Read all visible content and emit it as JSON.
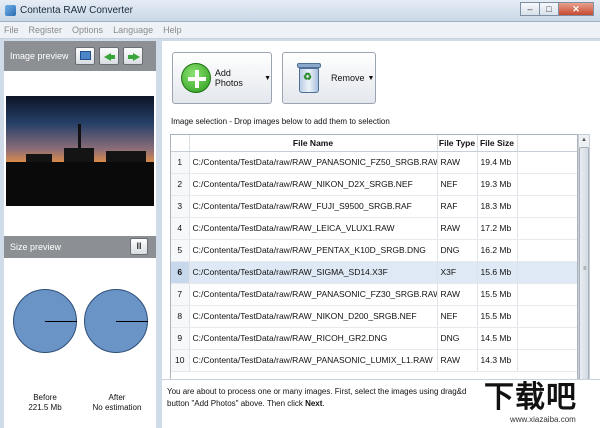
{
  "window": {
    "title": "Contenta RAW Converter",
    "min": "‒",
    "max": "□",
    "close": "✕"
  },
  "menu": [
    "File",
    "Register",
    "Options",
    "Language",
    "Help"
  ],
  "left": {
    "preview_label": "Image preview",
    "size_label": "Size preview",
    "pause": "II",
    "before_label": "Before",
    "before_value": "221.5 Mb",
    "after_label": "After",
    "after_value": "No estimation"
  },
  "toolbar": {
    "add": "Add Photos",
    "remove": "Remove",
    "caret": "▼"
  },
  "selection_label": "Image selection - Drop images below to add them to selection",
  "table": {
    "headers": {
      "name": "File Name",
      "type": "File Type",
      "size": "File Size"
    },
    "rows": [
      {
        "n": "1",
        "name": "C:/Contenta/TestData/raw/RAW_PANASONIC_FZ50_SRGB.RAW",
        "type": "RAW",
        "size": "19.4 Mb"
      },
      {
        "n": "2",
        "name": "C:/Contenta/TestData/raw/RAW_NIKON_D2X_SRGB.NEF",
        "type": "NEF",
        "size": "19.3 Mb"
      },
      {
        "n": "3",
        "name": "C:/Contenta/TestData/raw/RAW_FUJI_S9500_SRGB.RAF",
        "type": "RAF",
        "size": "18.3 Mb"
      },
      {
        "n": "4",
        "name": "C:/Contenta/TestData/raw/RAW_LEICA_VLUX1.RAW",
        "type": "RAW",
        "size": "17.2 Mb"
      },
      {
        "n": "5",
        "name": "C:/Contenta/TestData/raw/RAW_PENTAX_K10D_SRGB.DNG",
        "type": "DNG",
        "size": "16.2 Mb"
      },
      {
        "n": "6",
        "name": "C:/Contenta/TestData/raw/RAW_SIGMA_SD14.X3F",
        "type": "X3F",
        "size": "15.6 Mb"
      },
      {
        "n": "7",
        "name": "C:/Contenta/TestData/raw/RAW_PANASONIC_FZ30_SRGB.RAW",
        "type": "RAW",
        "size": "15.5 Mb"
      },
      {
        "n": "8",
        "name": "C:/Contenta/TestData/raw/RAW_NIKON_D200_SRGB.NEF",
        "type": "NEF",
        "size": "15.5 Mb"
      },
      {
        "n": "9",
        "name": "C:/Contenta/TestData/raw/RAW_RICOH_GR2.DNG",
        "type": "DNG",
        "size": "14.5 Mb"
      },
      {
        "n": "10",
        "name": "C:/Contenta/TestData/raw/RAW_PANASONIC_LUMIX_L1.RAW",
        "type": "RAW",
        "size": "14.3 Mb"
      }
    ]
  },
  "info": {
    "line1": "You are about to process one or many images. First, select the images using drag&d",
    "line2_pre": "button \"Add Photos\" above. Then click ",
    "line2_bold": "Next",
    "line2_post": "."
  },
  "watermark": {
    "big": "下载吧",
    "small": "www.xiazaiba.com"
  },
  "colors": {
    "accent": "#2b9a1e",
    "panel_header": "#8c9094",
    "pie": "#6a93c6",
    "selected_row": "#dfe9f6"
  }
}
